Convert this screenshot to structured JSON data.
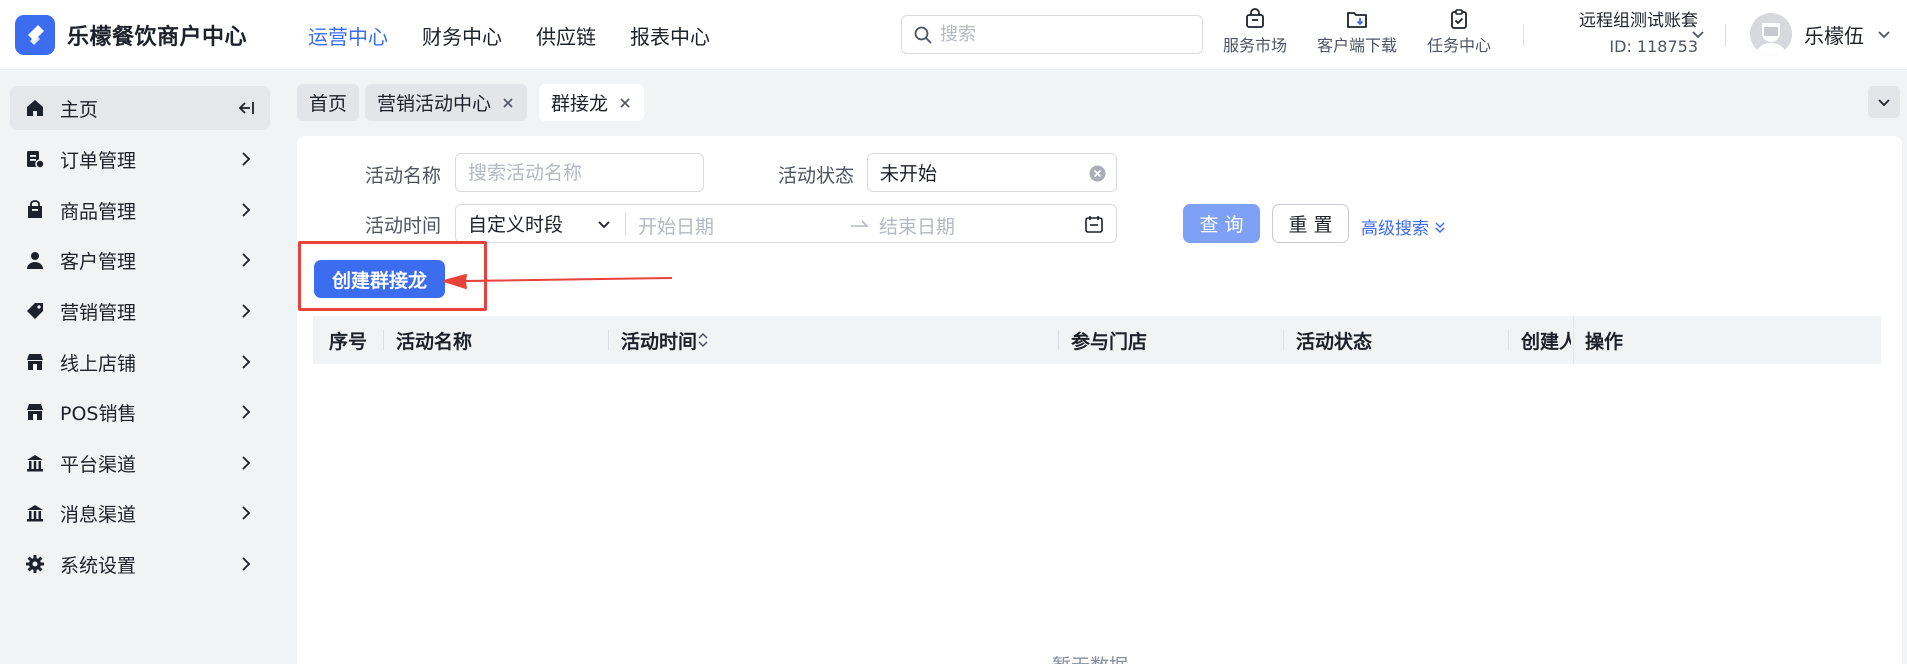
{
  "brand": {
    "name": "乐檬餐饮商户中心",
    "accent": "#3c6cf0"
  },
  "top_nav": [
    {
      "label": "运营中心",
      "active": true
    },
    {
      "label": "财务中心",
      "active": false
    },
    {
      "label": "供应链",
      "active": false
    },
    {
      "label": "报表中心",
      "active": false
    }
  ],
  "search": {
    "placeholder": "搜索",
    "icon": "search-icon"
  },
  "tools": [
    {
      "label": "服务市场",
      "icon": "shop-bag-icon"
    },
    {
      "label": "客户端下载",
      "icon": "folder-download-icon"
    },
    {
      "label": "任务中心",
      "icon": "clipboard-check-icon"
    }
  ],
  "account": {
    "name": "远程组测试账套",
    "id": "ID: 118753"
  },
  "user": {
    "name": "乐檬伍"
  },
  "sidebar": {
    "items": [
      {
        "label": "主页",
        "icon": "home-icon",
        "trailing": "collapse-icon"
      },
      {
        "label": "订单管理",
        "icon": "order-icon",
        "trailing": "chevron-right-icon"
      },
      {
        "label": "商品管理",
        "icon": "product-icon",
        "trailing": "chevron-right-icon"
      },
      {
        "label": "客户管理",
        "icon": "customer-icon",
        "trailing": "chevron-right-icon"
      },
      {
        "label": "营销管理",
        "icon": "tag-icon",
        "trailing": "chevron-right-icon"
      },
      {
        "label": "线上店铺",
        "icon": "store-icon",
        "trailing": "chevron-right-icon"
      },
      {
        "label": "POS销售",
        "icon": "pos-store-icon",
        "trailing": "chevron-right-icon"
      },
      {
        "label": "平台渠道",
        "icon": "platform-icon",
        "trailing": "chevron-right-icon"
      },
      {
        "label": "消息渠道",
        "icon": "message-icon",
        "trailing": "chevron-right-icon"
      },
      {
        "label": "系统设置",
        "icon": "gear-icon",
        "trailing": "chevron-right-icon"
      }
    ]
  },
  "tabs": [
    {
      "label": "首页",
      "closable": false,
      "active": false
    },
    {
      "label": "营销活动中心",
      "closable": true,
      "active": false
    },
    {
      "label": "群接龙",
      "closable": true,
      "active": true
    }
  ],
  "filters": {
    "name_label": "活动名称",
    "name_placeholder": "搜索活动名称",
    "status_label": "活动状态",
    "status_value": "未开始",
    "time_label": "活动时间",
    "time_mode": "自定义时段",
    "start_placeholder": "开始日期",
    "end_placeholder": "结束日期",
    "query_button": "查 询",
    "reset_button": "重 置",
    "advanced_link": "高级搜索"
  },
  "create_button": "创建群接龙",
  "table": {
    "columns": [
      "序号",
      "活动名称",
      "活动时间",
      "参与门店",
      "活动状态",
      "创建人",
      "操作"
    ],
    "empty_text": "暂无数据"
  },
  "colors": {
    "primary": "#3c6cf0",
    "query_button": "#7ea1f5",
    "annotation": "#e8423a"
  }
}
